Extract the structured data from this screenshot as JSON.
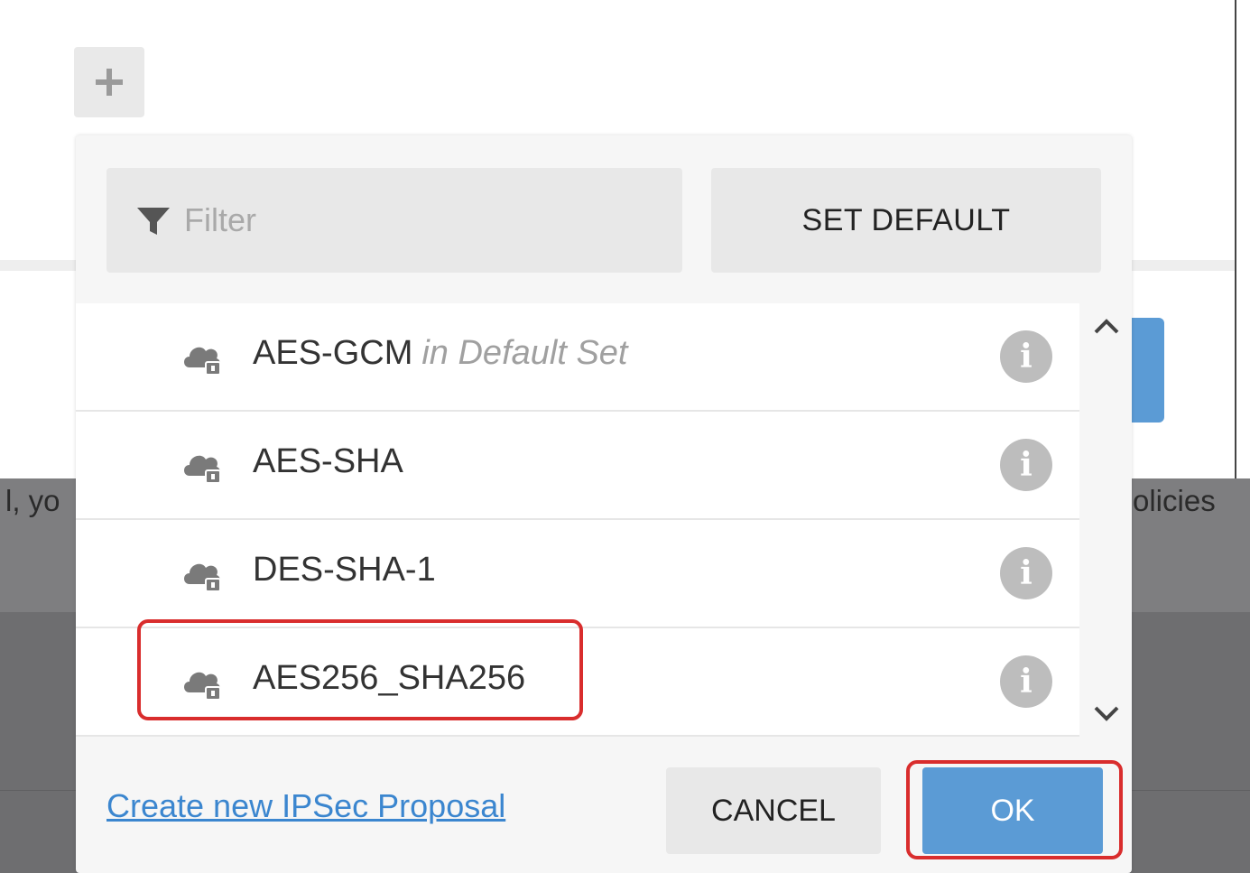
{
  "background": {
    "left_text": "l, yo",
    "right_text": "olicies"
  },
  "add_button": {
    "icon": "plus-icon"
  },
  "filter": {
    "icon": "filter-icon",
    "placeholder": "Filter"
  },
  "set_default_label": "SET DEFAULT",
  "proposals": [
    {
      "name": "AES-GCM",
      "note": "in Default Set"
    },
    {
      "name": "AES-SHA"
    },
    {
      "name": "DES-SHA-1"
    },
    {
      "name": "AES256_SHA256"
    }
  ],
  "footer": {
    "create_link": "Create new IPSec Proposal",
    "cancel_label": "CANCEL",
    "ok_label": "OK"
  },
  "colors": {
    "accent_blue": "#5b9bd5",
    "highlight_red": "#d92d2d",
    "link_blue": "#3b86cf"
  }
}
